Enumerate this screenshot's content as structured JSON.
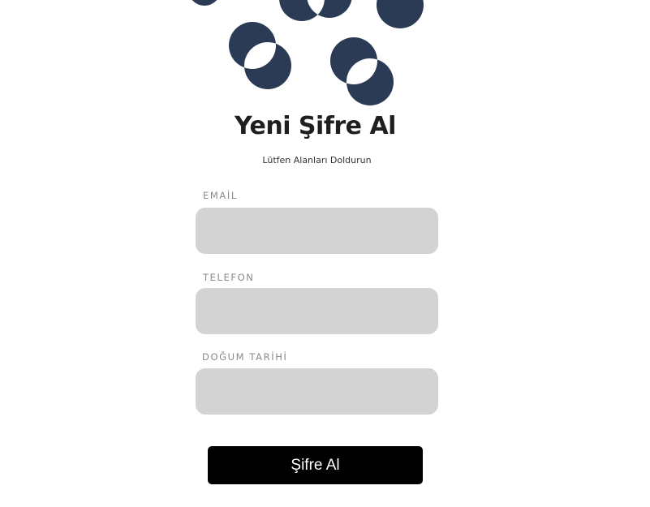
{
  "header": {
    "title": "Yeni Şifre Al",
    "subtitle": "Lütfen Alanları Doldurun",
    "logo_icon": "overlapping-circles-logo"
  },
  "form": {
    "email": {
      "label": "EMAİL",
      "value": "",
      "placeholder": ""
    },
    "phone": {
      "label": "TELEFON",
      "value": "",
      "placeholder": ""
    },
    "birthdate": {
      "label": "DOĞUM TARİHİ",
      "value": "",
      "placeholder": ""
    },
    "submit_label": "Şifre Al"
  },
  "colors": {
    "logo": "#2b3a55",
    "input_bg": "#d3d3d3",
    "button_bg": "#000000",
    "button_text": "#ffffff",
    "label": "#8a8a8a",
    "title": "#1f1f1f"
  }
}
